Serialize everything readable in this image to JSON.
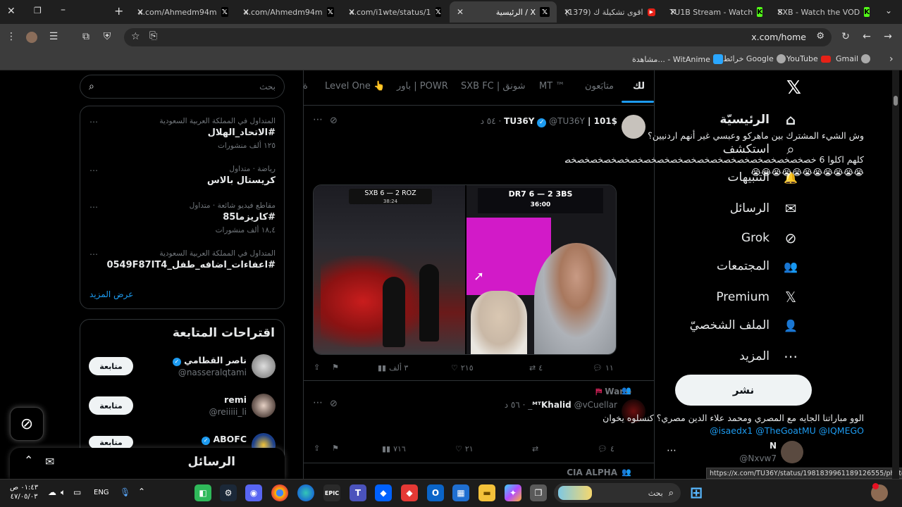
{
  "browser": {
    "tabs": [
      {
        "title": "x.com/Ahmedm94m",
        "active": false
      },
      {
        "title": "x.com/Ahmedm94m",
        "active": false
      },
      {
        "title": "x.com/i1wte/status/1",
        "active": false
      },
      {
        "title": "الرئيسية / X",
        "active": true
      },
      {
        "title": "(1379) اقوى تشكيلة ك",
        "active": false
      },
      {
        "title": "TU1B Stream - Watch",
        "active": false
      },
      {
        "title": "SXB - Watch the VOD",
        "active": false
      }
    ],
    "url": "x.com/home",
    "bookmarks": [
      "Gmail",
      "YouTube",
      "خرائط Google",
      "مشاهدة... - WitAnime"
    ],
    "status_url": "https://x.com/TU36Y/status/1981839961189126555/photo/1"
  },
  "nav": {
    "items": [
      {
        "label": "الرئيسيّة",
        "icon": "home-icon",
        "glyph": "⌂"
      },
      {
        "label": "استكشف",
        "icon": "search-icon",
        "glyph": "⌕"
      },
      {
        "label": "التنبيهات",
        "icon": "bell-icon",
        "glyph": "🔔"
      },
      {
        "label": "الرسائل",
        "icon": "mail-icon",
        "glyph": "✉"
      },
      {
        "label": "Grok",
        "icon": "grok-icon",
        "glyph": "⊘"
      },
      {
        "label": "المجتمعات",
        "icon": "communities-icon",
        "glyph": "👥"
      },
      {
        "label": "Premium",
        "icon": "x-logo-icon",
        "glyph": "𝕏"
      },
      {
        "label": "الملف الشخصيّ",
        "icon": "profile-icon",
        "glyph": "👤"
      },
      {
        "label": "المزيد",
        "icon": "more-icon",
        "glyph": "⋯"
      }
    ],
    "post_label": "نشر",
    "account_name": "N",
    "account_handle": "@Nxvw7"
  },
  "feed": {
    "tabs": [
      "لك",
      "متابَعون",
      "MT ™",
      "SXB FC | شونق",
      "باور | POWR",
      "Level One 👆",
      "ة"
    ],
    "tweets": [
      {
        "name": "101$ | TU36Y",
        "handle": "@TU36Y",
        "time": "٥٤ د",
        "line1": "وش الشيء المشترك بين ماهركو وعبسي غير أنهم اردنيين؟",
        "line2": "كلهم اكلوا 6 خصخصخصخصخصخصخصخصخصخصخصخصخصخصخصخصخصخصخصخصخ😭😭",
        "line3": "😭😭😭😭😭😭😭😭😭😭😭",
        "media": {
          "left_score": "SXB 6 — 2 ROZ",
          "left_clock": "38:24",
          "right_score": "DR7 6 — 2 3BS",
          "right_clock": "36:00"
        },
        "replies": "١١",
        "reposts": "٤",
        "likes": "٢١٥",
        "views": "٣ ألف"
      },
      {
        "reposted_by": "Wano",
        "name": "ᴹᵀKhalid",
        "handle": "@vCuellar_",
        "time": "٥٦ د",
        "line1": "الوو مباراتنا الجايه مع المصري ومحمد علاء الدين مصري؟ كنسلوه يخوان",
        "line2": "@isaedx1 @TheGoatMU @IQMEGO",
        "replies": "٤",
        "reposts": "",
        "likes": "٢١",
        "views": "٧١٦"
      },
      {
        "reposted_by": "CIA ALPHA"
      }
    ]
  },
  "search": {
    "placeholder": "بحث"
  },
  "trends": [
    {
      "meta": "المتداول في المملكة العربية السعودية",
      "title": "#الاتحاد_الهلال",
      "count": "١٢٥ ألف منشورات"
    },
    {
      "meta": "رياضة · متداول",
      "title": "كريستال بالاس",
      "count": ""
    },
    {
      "meta": "مقاطع فيديو شائعة · متداول",
      "title": "#كاريزما85",
      "count": "١٨,٤ ألف منشورات"
    },
    {
      "meta": "المتداول في المملكة العربية السعودية",
      "title": "#اعفاءات_اضافه_طفل_0549F87IT4",
      "count": ""
    }
  ],
  "trends_more": "عرض المزيد",
  "follow": {
    "title": "اقتراحات المتابعة",
    "button": "متابعة",
    "people": [
      {
        "name": "ناصر القطامي",
        "handle": "@nasseralqtami",
        "verified": true
      },
      {
        "name": "remi",
        "handle": "@reiiiii_li",
        "verified": false
      },
      {
        "name": "ABOFC",
        "handle": "",
        "verified": true
      }
    ]
  },
  "messages_drawer": {
    "title": "الرسائل"
  },
  "taskbar": {
    "time": "٠١:٤٣ ص",
    "date": "٤٧/٠٥/٠٣",
    "lang": "ENG",
    "search_placeholder": "بحث"
  },
  "colors": {
    "accent": "#1d9bf0",
    "bg": "#000000",
    "border": "#2f3336",
    "muted": "#71767b"
  }
}
